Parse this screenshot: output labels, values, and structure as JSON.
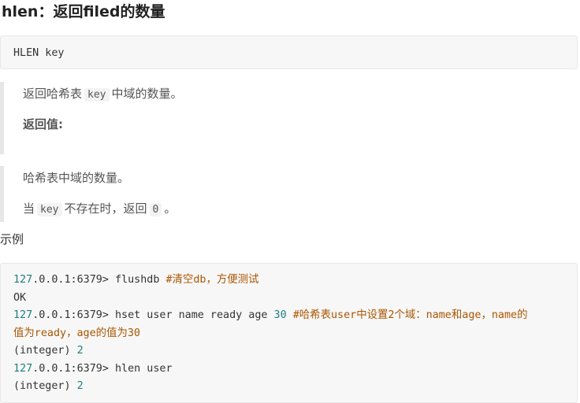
{
  "heading": "hlen：返回filed的数量",
  "syntax_code": "HLEN key",
  "description": {
    "pre": "返回哈希表",
    "code": "key",
    "post": "中域的数量。"
  },
  "return_label": "返回值:",
  "return_desc": "哈希表中域的数量。",
  "return_cond": {
    "pre": "当",
    "code": "key",
    "mid": "不存在时，返回",
    "zero": "0",
    "post": "。"
  },
  "example_label": "示例",
  "example_lines": {
    "l1": {
      "addr_num": "127",
      "addr_rest": ".0.0.1:6379> flushdb ",
      "comment": "#清空db，方便测试"
    },
    "l2": {
      "text": "OK"
    },
    "l3": {
      "addr_num": "127",
      "cmd": ".0.0.1:6379> hset user name ready age ",
      "num": "30",
      "space": " ",
      "comment": "#哈希表user中设置2个域：name和age，name的"
    },
    "l4": {
      "comment": "值为ready，age的值为30"
    },
    "l5": {
      "text": "(integer) ",
      "num": "2"
    },
    "l6": {
      "addr_num": "127",
      "cmd": ".0.0.1:6379> hlen user"
    },
    "l7": {
      "text": "(integer) ",
      "num": "2"
    }
  }
}
